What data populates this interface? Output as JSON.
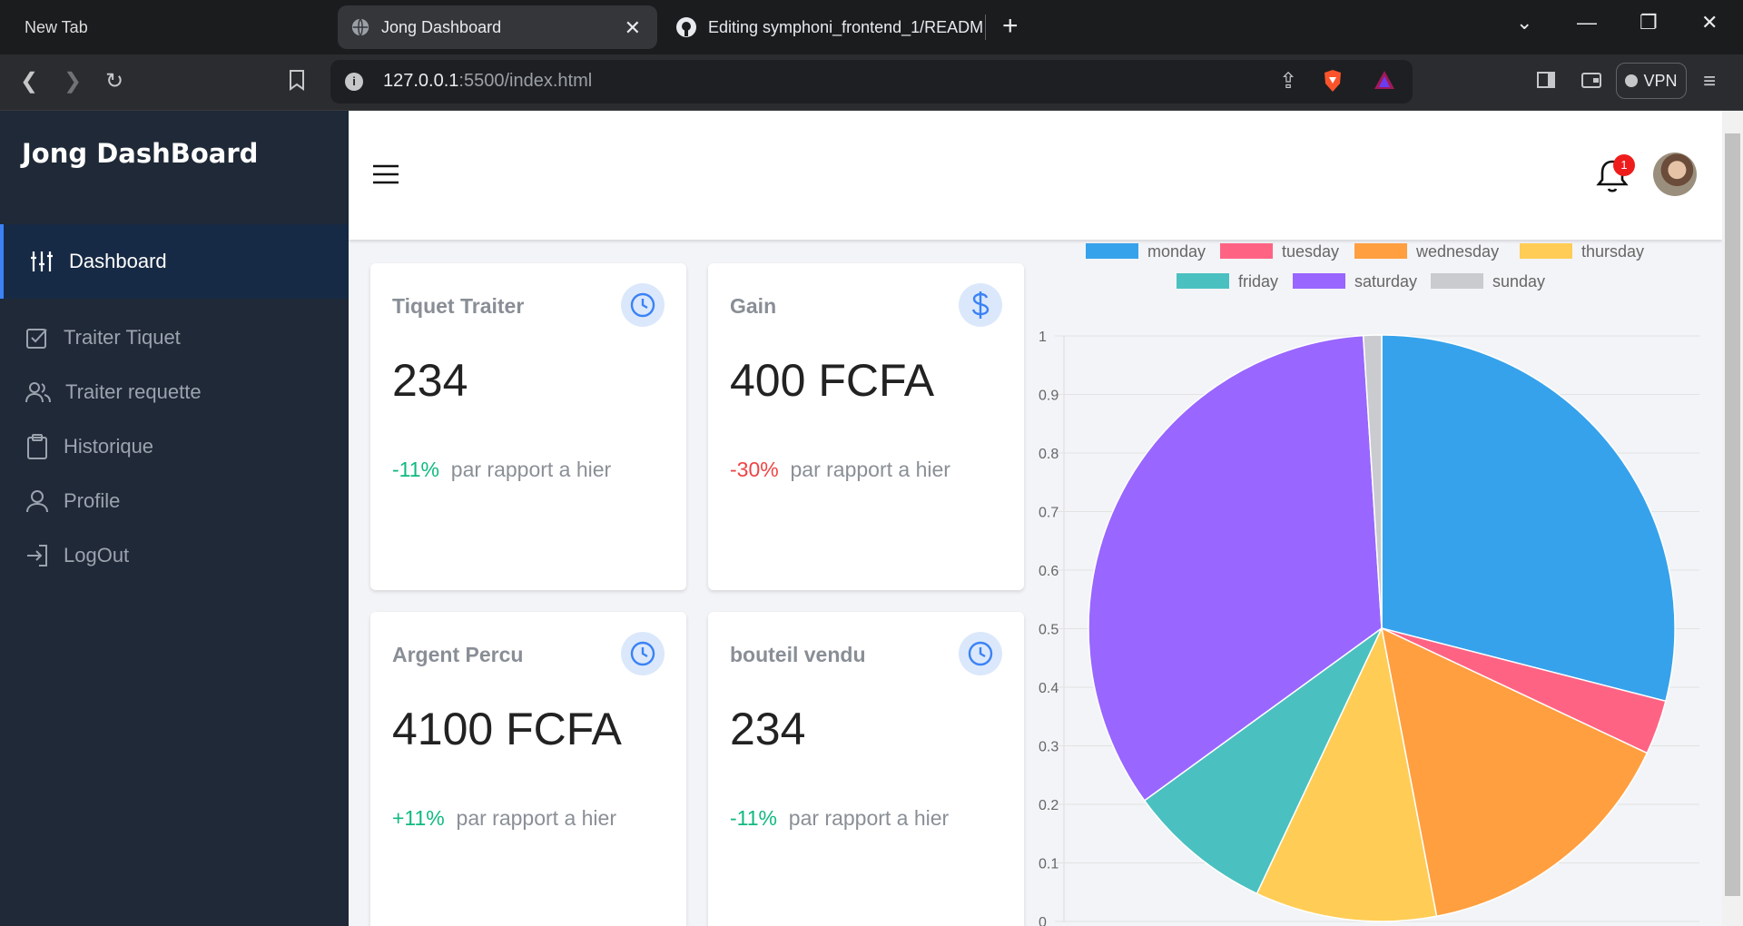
{
  "browser": {
    "tabs": [
      {
        "title": "New Tab"
      },
      {
        "title": "Jong Dashboard"
      },
      {
        "title": "Editing symphoni_frontend_1/READM"
      }
    ],
    "url_host": "127.0.0.1",
    "url_rest": ":5500/index.html",
    "vpn_label": "VPN"
  },
  "sidebar": {
    "brand": "Jong DashBoard",
    "items": [
      {
        "label": "Dashboard",
        "icon": "sliders-icon",
        "active": true
      },
      {
        "label": "Traiter Tiquet",
        "icon": "checkbox-icon"
      },
      {
        "label": "Traiter requette",
        "icon": "users-icon"
      },
      {
        "label": "Historique",
        "icon": "clipboard-icon"
      },
      {
        "label": "Profile",
        "icon": "user-icon"
      },
      {
        "label": "LogOut",
        "icon": "logout-icon"
      }
    ]
  },
  "header": {
    "notification_count": "1"
  },
  "cards": [
    {
      "title": "Tiquet Traiter",
      "value": "234",
      "delta": "-11%",
      "delta_text": "par rapport a hier",
      "icon": "clock-icon"
    },
    {
      "title": "Gain",
      "value": "400 FCFA",
      "delta": "-30%",
      "delta_text": "par rapport a hier",
      "icon": "dollar-icon"
    },
    {
      "title": "Argent Percu",
      "value": "4100 FCFA",
      "delta": "+11%",
      "delta_text": "par rapport a hier",
      "icon": "clock-icon"
    },
    {
      "title": "bouteil vendu",
      "value": "234",
      "delta": "-11%",
      "delta_text": "par rapport a hier",
      "icon": "clock-icon"
    }
  ],
  "colors": {
    "accent": "#3b82f6",
    "sidebar_bg": "#1f2937",
    "positive": "#10b981",
    "negative": "#ef4444"
  },
  "chart_data": {
    "type": "pie",
    "legend_position": "top",
    "categories": [
      "monday",
      "tuesday",
      "wednesday",
      "thursday",
      "friday",
      "saturday",
      "sunday"
    ],
    "values": [
      29,
      3,
      15,
      10,
      8,
      34,
      1
    ],
    "colors": [
      "#36a2eb",
      "#ff6384",
      "#ff9f40",
      "#ffcd56",
      "#4bc0c0",
      "#9966ff",
      "#c9cbcf"
    ],
    "y_ticks": [
      "0",
      "0.1",
      "0.2",
      "0.3",
      "0.4",
      "0.5",
      "0.6",
      "0.7",
      "0.8",
      "0.9",
      "1"
    ],
    "grid": true
  }
}
